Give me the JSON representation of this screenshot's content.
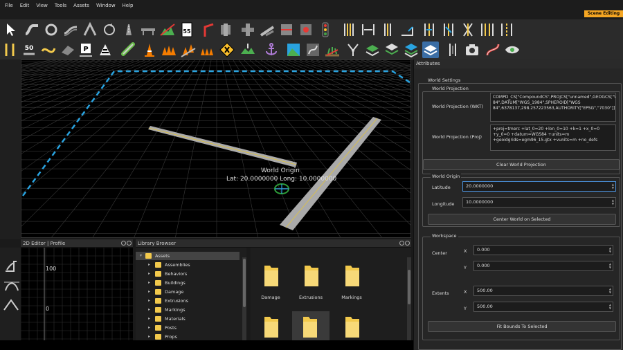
{
  "menu": {
    "items": [
      "File",
      "Edit",
      "View",
      "Tools",
      "Assets",
      "Window",
      "Help"
    ],
    "badge": "Scene Editing"
  },
  "viewport": {
    "origin_title": "World Origin",
    "origin_coords": "Lat: 20.0000000 Long: 10.0000000"
  },
  "editor2d": {
    "title": "2D Editor | Profile",
    "y_high": "100",
    "y_low": "0"
  },
  "library": {
    "title": "Library Browser",
    "tree": [
      {
        "label": "Assets"
      },
      {
        "label": "Assemblies"
      },
      {
        "label": "Behaviors"
      },
      {
        "label": "Buildings"
      },
      {
        "label": "Damage"
      },
      {
        "label": "Extrusions"
      },
      {
        "label": "Markings"
      },
      {
        "label": "Materials"
      },
      {
        "label": "Posts"
      },
      {
        "label": "Props"
      }
    ],
    "folders": [
      {
        "label": "Damage"
      },
      {
        "label": "Extrusions"
      },
      {
        "label": "Markings"
      }
    ]
  },
  "attributes": {
    "title": "Attributes",
    "world_settings": "World Settings",
    "world_projection": {
      "group": "World Projection",
      "wkt_label": "World Projection (WKT)",
      "wkt_value": "COMPD_CS[\"CompoundCS\",PROJCS[\"unnamed\",GEOGCS[\"WGS 84\",DATUM[\"WGS_1984\",SPHEROID[\"WGS 84\",6378137,298.257223563,AUTHORITY[\"EPSG\",\"7030\"]]",
      "proj_label": "World Projection (Proj)",
      "proj_value": "+proj=tmerc +lat_0=20 +lon_0=10 +k=1 +x_0=0 +y_0=0 +datum=WGS84 +units=m +geoidgrids=egm96_15.gtx +vunits=m +no_defs",
      "clear_button": "Clear World Projection"
    },
    "world_origin": {
      "group": "World Origin",
      "lat_label": "Latitude",
      "lat_value": "20.0000000",
      "lon_label": "Longitude",
      "lon_value": "10.0000000",
      "center_button": "Center World on Selected"
    },
    "workspace": {
      "group": "Workspace",
      "center_label": "Center",
      "center_x_label": "X",
      "center_x": "0.000",
      "center_y_label": "Y",
      "center_y": "0.000",
      "extents_label": "Extents",
      "extents_x_label": "X",
      "extents_x": "500.00",
      "extents_y_label": "Y",
      "extents_y": "500.00",
      "fit_button": "Fit Bounds To Selected"
    }
  },
  "colors": {
    "accent": "#4a90d9",
    "badge": "#f5a623",
    "workspace_line": "#29a3e0",
    "folder": "#f2c94c"
  }
}
